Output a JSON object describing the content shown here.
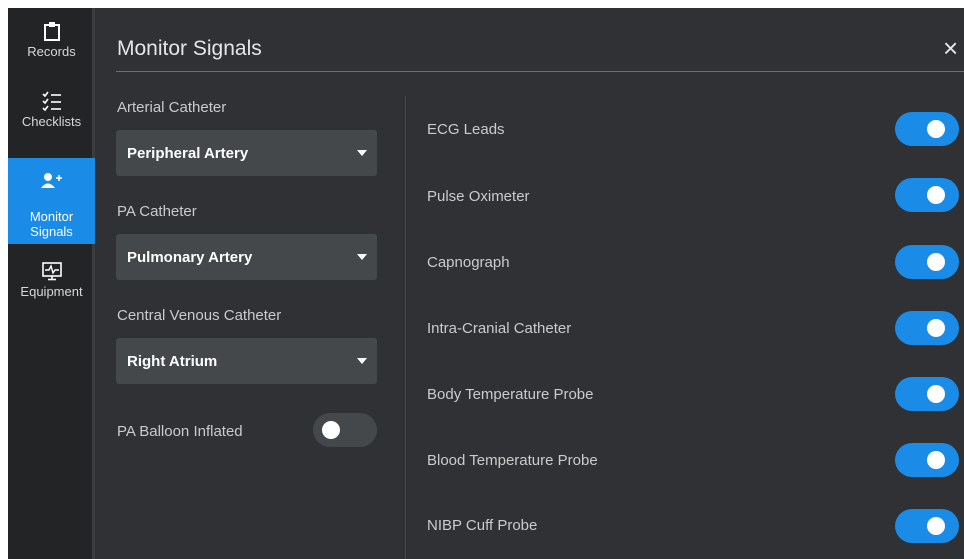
{
  "sidebar": {
    "items": [
      {
        "label": "Records",
        "icon": "clipboard-icon"
      },
      {
        "label": "Checklists",
        "icon": "checklist-icon"
      },
      {
        "label": "Monitor\nSignals",
        "icon": "add-user-icon",
        "active": true
      },
      {
        "label": "Equipment",
        "icon": "monitor-pulse-icon"
      }
    ]
  },
  "header": {
    "title": "Monitor Signals",
    "close": "×"
  },
  "catheters": {
    "arterial": {
      "label": "Arterial Catheter",
      "value": "Peripheral Artery"
    },
    "pa": {
      "label": "PA Catheter",
      "value": "Pulmonary Artery"
    },
    "central": {
      "label": "Central Venous Catheter",
      "value": "Right Atrium"
    },
    "balloon": {
      "label": "PA Balloon Inflated",
      "on": false
    }
  },
  "signals": [
    {
      "label": "ECG Leads",
      "on": true
    },
    {
      "label": "Pulse Oximeter",
      "on": true
    },
    {
      "label": "Capnograph",
      "on": true
    },
    {
      "label": "Intra-Cranial Catheter",
      "on": true
    },
    {
      "label": "Body Temperature Probe",
      "on": true
    },
    {
      "label": "Blood Temperature Probe",
      "on": true
    },
    {
      "label": "NIBP Cuff Probe",
      "on": true
    }
  ],
  "colors": {
    "accent": "#1a8ce8",
    "background": "#2f3134",
    "sidebar": "#222426",
    "control": "#45484b"
  }
}
